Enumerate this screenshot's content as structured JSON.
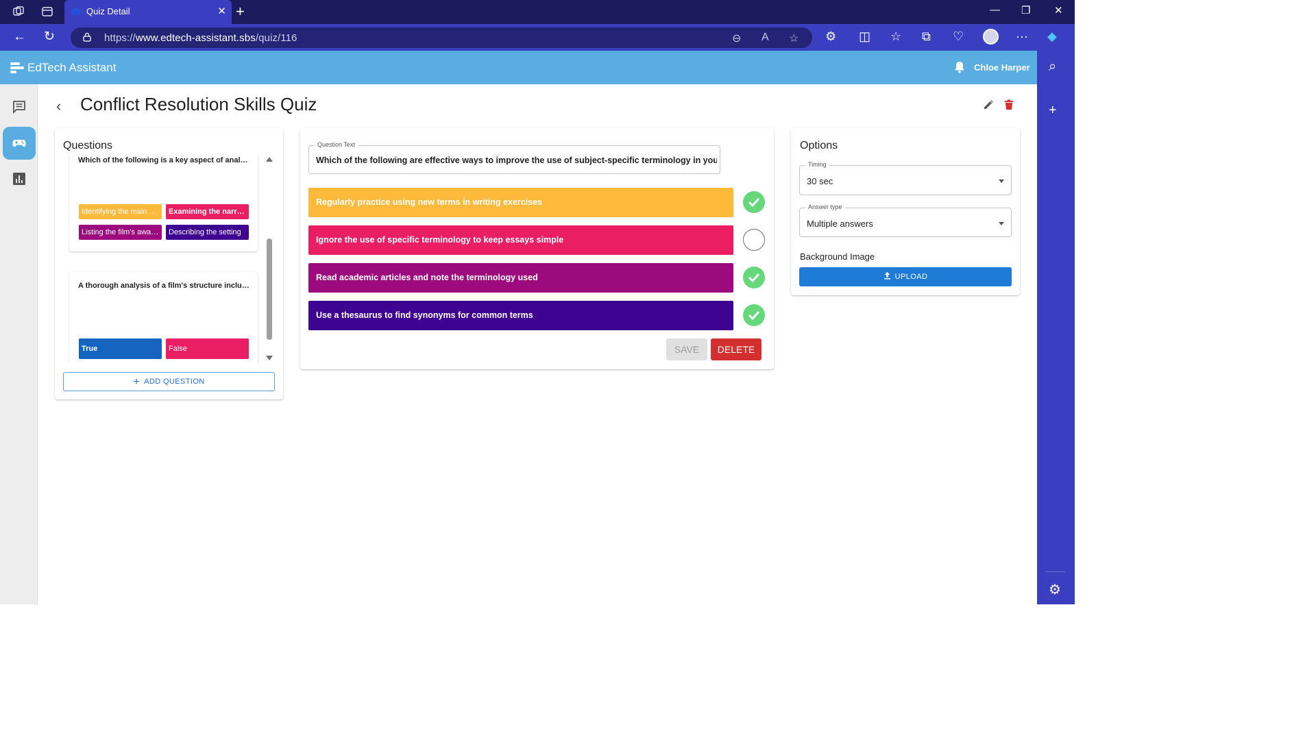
{
  "browser": {
    "tab_title": "Quiz Detail",
    "url_prefix": "https://",
    "url_domain": "www.edtech-assistant.sbs",
    "url_path": "/quiz/116"
  },
  "app": {
    "brand": "EdTech Assistant",
    "user_name": "Chloe Harper",
    "accent_color": "#5aade1"
  },
  "page": {
    "title": "Conflict Resolution Skills Quiz"
  },
  "questions_panel": {
    "title": "Questions",
    "items": [
      {
        "text": "Which of the following is a key aspect of analysing a film's structure?",
        "answers": [
          {
            "label": "Identifying the main character",
            "color": "#ffb93b"
          },
          {
            "label": "Examining the narrative arc",
            "color": "#e91e63"
          },
          {
            "label": "Listing the film's awards",
            "color": "#9c0a7e"
          },
          {
            "label": "Describing the setting",
            "color": "#3f0391"
          }
        ]
      },
      {
        "text": "A thorough analysis of a film's structure includes examining its themes.",
        "answers": [
          {
            "label": "True",
            "color": "#1565c0"
          },
          {
            "label": "False",
            "color": "#e91e63"
          }
        ]
      }
    ],
    "add_button": "ADD QUESTION"
  },
  "editor": {
    "question_label": "Question Text",
    "question_text": "Which of the following are effective ways to improve the use of subject-specific terminology in your essays?",
    "answers": [
      {
        "text": "Regularly practice using new terms in writing exercises",
        "color": "#ffb93b",
        "correct": true
      },
      {
        "text": "Ignore the use of specific terminology to keep essays simple",
        "color": "#e91e63",
        "correct": false
      },
      {
        "text": "Read academic articles and note the terminology used",
        "color": "#9c0a7e",
        "correct": true
      },
      {
        "text": "Use a thesaurus to find synonyms for common terms",
        "color": "#3f0391",
        "correct": true
      }
    ],
    "save_label": "SAVE",
    "delete_label": "DELETE"
  },
  "options": {
    "title": "Options",
    "timing_label": "Timing",
    "timing_value": "30 sec",
    "answer_type_label": "Answer type",
    "answer_type_value": "Multiple answers",
    "background_label": "Background Image",
    "upload_label": "UPLOAD"
  }
}
